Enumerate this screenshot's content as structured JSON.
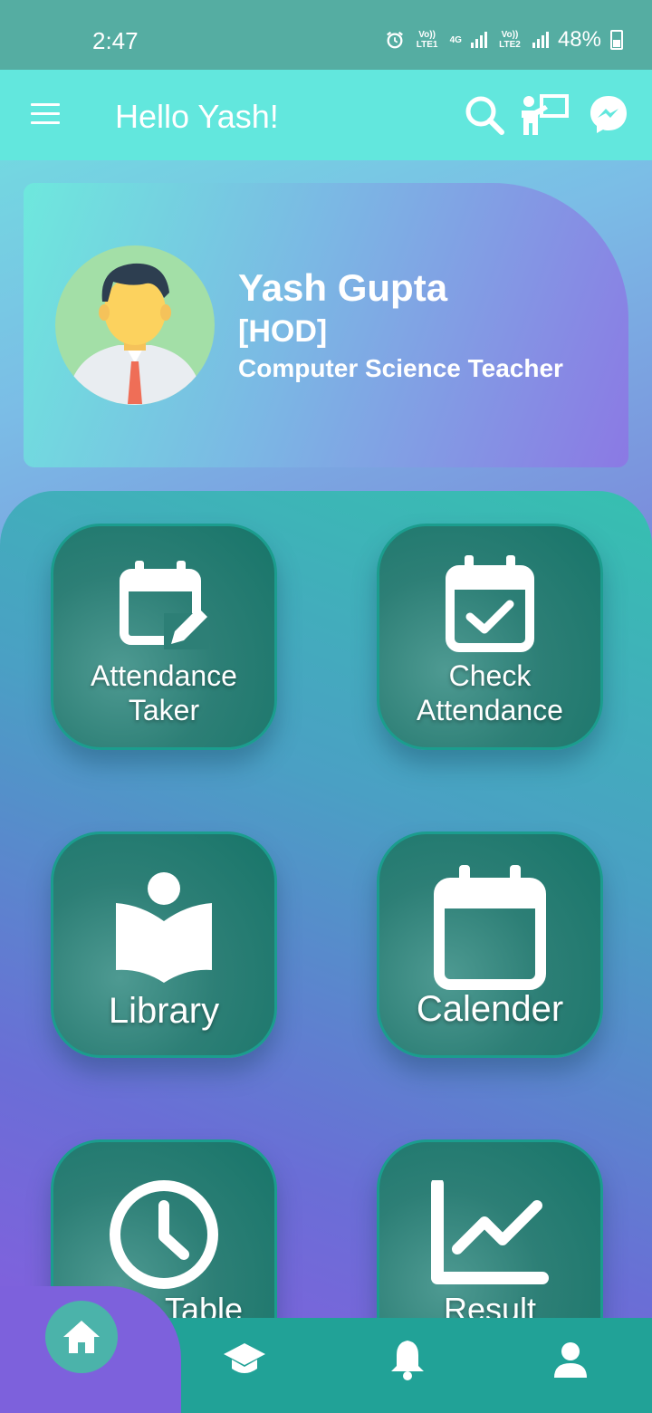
{
  "status_bar": {
    "time": "2:47",
    "net1": "Vo)) LTE1",
    "net_4g": "4G",
    "net2": "Vo)) LTE2",
    "battery": "48%"
  },
  "app_bar": {
    "greeting": "Hello Yash!"
  },
  "profile": {
    "name": "Yash Gupta",
    "role": "[HOD]",
    "subject": "Computer Science Teacher"
  },
  "tiles": [
    {
      "label_line1": "Attendance",
      "label_line2": "Taker",
      "icon": "calendar-edit-icon"
    },
    {
      "label_line1": "Check",
      "label_line2": "Attendance",
      "icon": "calendar-check-icon"
    },
    {
      "label": "Library",
      "icon": "reader-icon"
    },
    {
      "label": "Calender",
      "icon": "calendar-icon"
    },
    {
      "label": "Time Table",
      "icon": "clock-icon"
    },
    {
      "label": "Result",
      "icon": "chart-line-icon"
    }
  ],
  "bottom_nav": [
    "home-icon",
    "graduation-cap-icon",
    "bell-icon",
    "person-icon"
  ],
  "colors": {
    "status_bar": "#55ada2",
    "app_bar": "#62e7dd",
    "tile": "#2d7f76",
    "bottom_nav": "#21a297"
  }
}
